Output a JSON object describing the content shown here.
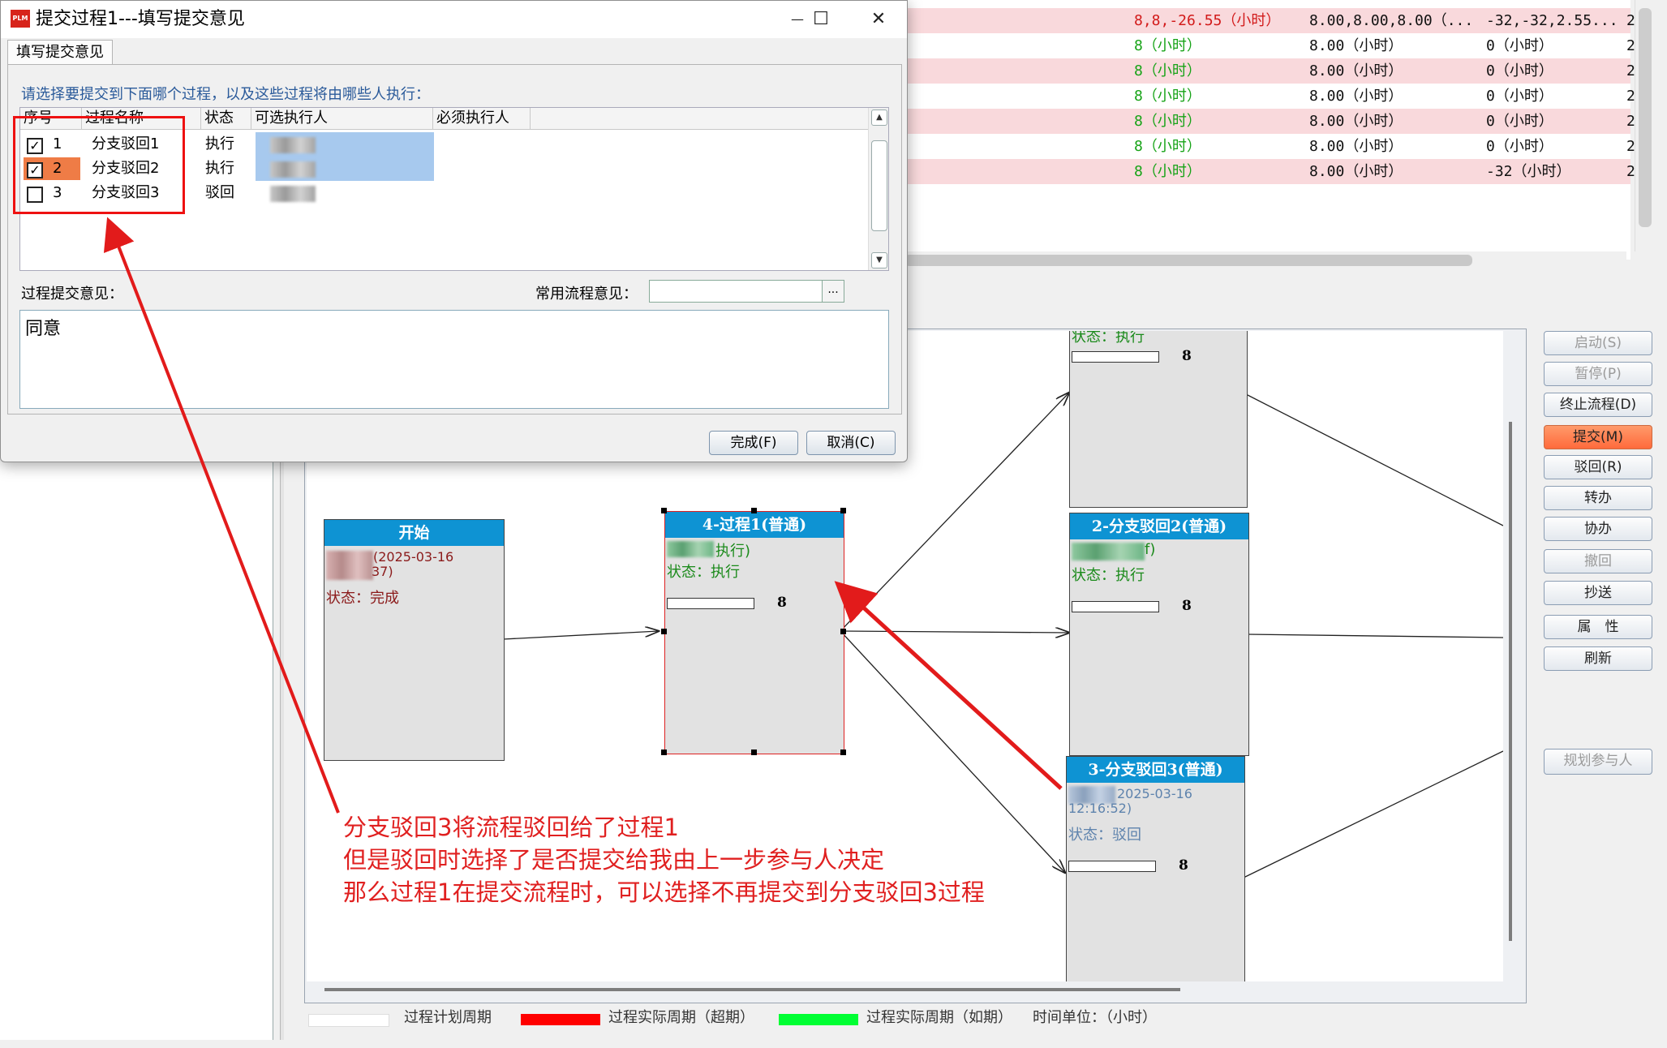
{
  "dialog": {
    "title": "提交过程1---填写提交意见",
    "app_icon": "PLM",
    "tab": "填写提交意见",
    "prompt": "请选择要提交到下面哪个过程，以及这些过程将由哪些人执行：",
    "columns": [
      "序号",
      "过程名称",
      "状态",
      "可选执行人",
      "必须执行人"
    ],
    "rows": [
      {
        "seq": "1",
        "name": "分支驳回1",
        "status": "执行",
        "checked": true
      },
      {
        "seq": "2",
        "name": "分支驳回2",
        "status": "执行",
        "checked": true
      },
      {
        "seq": "3",
        "name": "分支驳回3",
        "status": "驳回",
        "checked": false
      }
    ],
    "opinion_label": "过程提交意见：",
    "common_label": "常用流程意见：",
    "common_button": "...",
    "opinion_value": "同意",
    "finish_button": "完成(F)",
    "cancel_button": "取消(C)",
    "minimize": "—",
    "maximize": "☐",
    "close": "✕"
  },
  "bg_table": {
    "rows": [
      {
        "c1": "8,8,-26.55（小时）",
        "c2": "8.00,8.00,8.00（...",
        "c3": "-32,-32,2.55...",
        "c4": "2",
        "pink": true,
        "red": true
      },
      {
        "c1": "8（小时）",
        "c2": "8.00（小时）",
        "c3": "0（小时）",
        "c4": "2",
        "pink": false,
        "red": false
      },
      {
        "c1": "8（小时）",
        "c2": "8.00（小时）",
        "c3": "0（小时）",
        "c4": "2",
        "pink": true,
        "red": false
      },
      {
        "c1": "8（小时）",
        "c2": "8.00（小时）",
        "c3": "0（小时）",
        "c4": "2",
        "pink": false,
        "red": false
      },
      {
        "c1": "8（小时）",
        "c2": "8.00（小时）",
        "c3": "0（小时）",
        "c4": "2",
        "pink": true,
        "red": false
      },
      {
        "c1": "8（小时）",
        "c2": "8.00（小时）",
        "c3": "0（小时）",
        "c4": "2",
        "pink": false,
        "red": false
      },
      {
        "c1": "8（小时）",
        "c2": "8.00（小时）",
        "c3": "-32（小时）",
        "c4": "2",
        "pink": true,
        "red": false
      }
    ]
  },
  "flow": {
    "start": {
      "title": "开始",
      "date": "(2025-03-16",
      "date2": "37)",
      "status": "状态：完成"
    },
    "p1": {
      "title": "4-过程1(普通)",
      "exec": "执行)",
      "status": "状态：执行",
      "value": "8"
    },
    "top": {
      "status": "状态：执行",
      "value": "8"
    },
    "b2": {
      "title": "2-分支驳回2(普通)",
      "exec": "f)",
      "status": "状态：执行",
      "value": "8"
    },
    "b3": {
      "title": "3-分支驳回3(普通)",
      "date": "2025-03-16",
      "date2": "12:16:52)",
      "status": "状态：驳回",
      "value": "8"
    }
  },
  "side_buttons": [
    {
      "label": "启动(S)",
      "state": "disabled"
    },
    {
      "label": "暂停(P)",
      "state": "disabled"
    },
    {
      "label": "终止流程(D)",
      "state": "normal"
    },
    {
      "label": "提交(M)",
      "state": "active"
    },
    {
      "label": "驳回(R)",
      "state": "normal"
    },
    {
      "label": "转办",
      "state": "normal"
    },
    {
      "label": "协办",
      "state": "normal"
    },
    {
      "label": "撤回",
      "state": "disabled"
    },
    {
      "label": "抄送",
      "state": "normal"
    },
    {
      "label": "属　性",
      "state": "normal"
    },
    {
      "label": "刷新",
      "state": "normal"
    },
    {
      "label": "规划参与人",
      "state": "disabled"
    }
  ],
  "legend": {
    "plan": "过程计划周期",
    "over": "过程实际周期（超期）",
    "ontime": "过程实际周期（如期）",
    "unit": "时间单位：（小时）",
    "colors": {
      "plan": "#ffffff",
      "over": "#ff0000",
      "ontime": "#00ff33"
    }
  },
  "annotation": {
    "lines": [
      "分支驳回3将流程驳回给了过程1",
      "但是驳回时选择了是否提交给我由上一步参与人决定",
      "那么过程1在提交流程时，可以选择不再提交到分支驳回3过程"
    ],
    "color": "#e02020"
  }
}
